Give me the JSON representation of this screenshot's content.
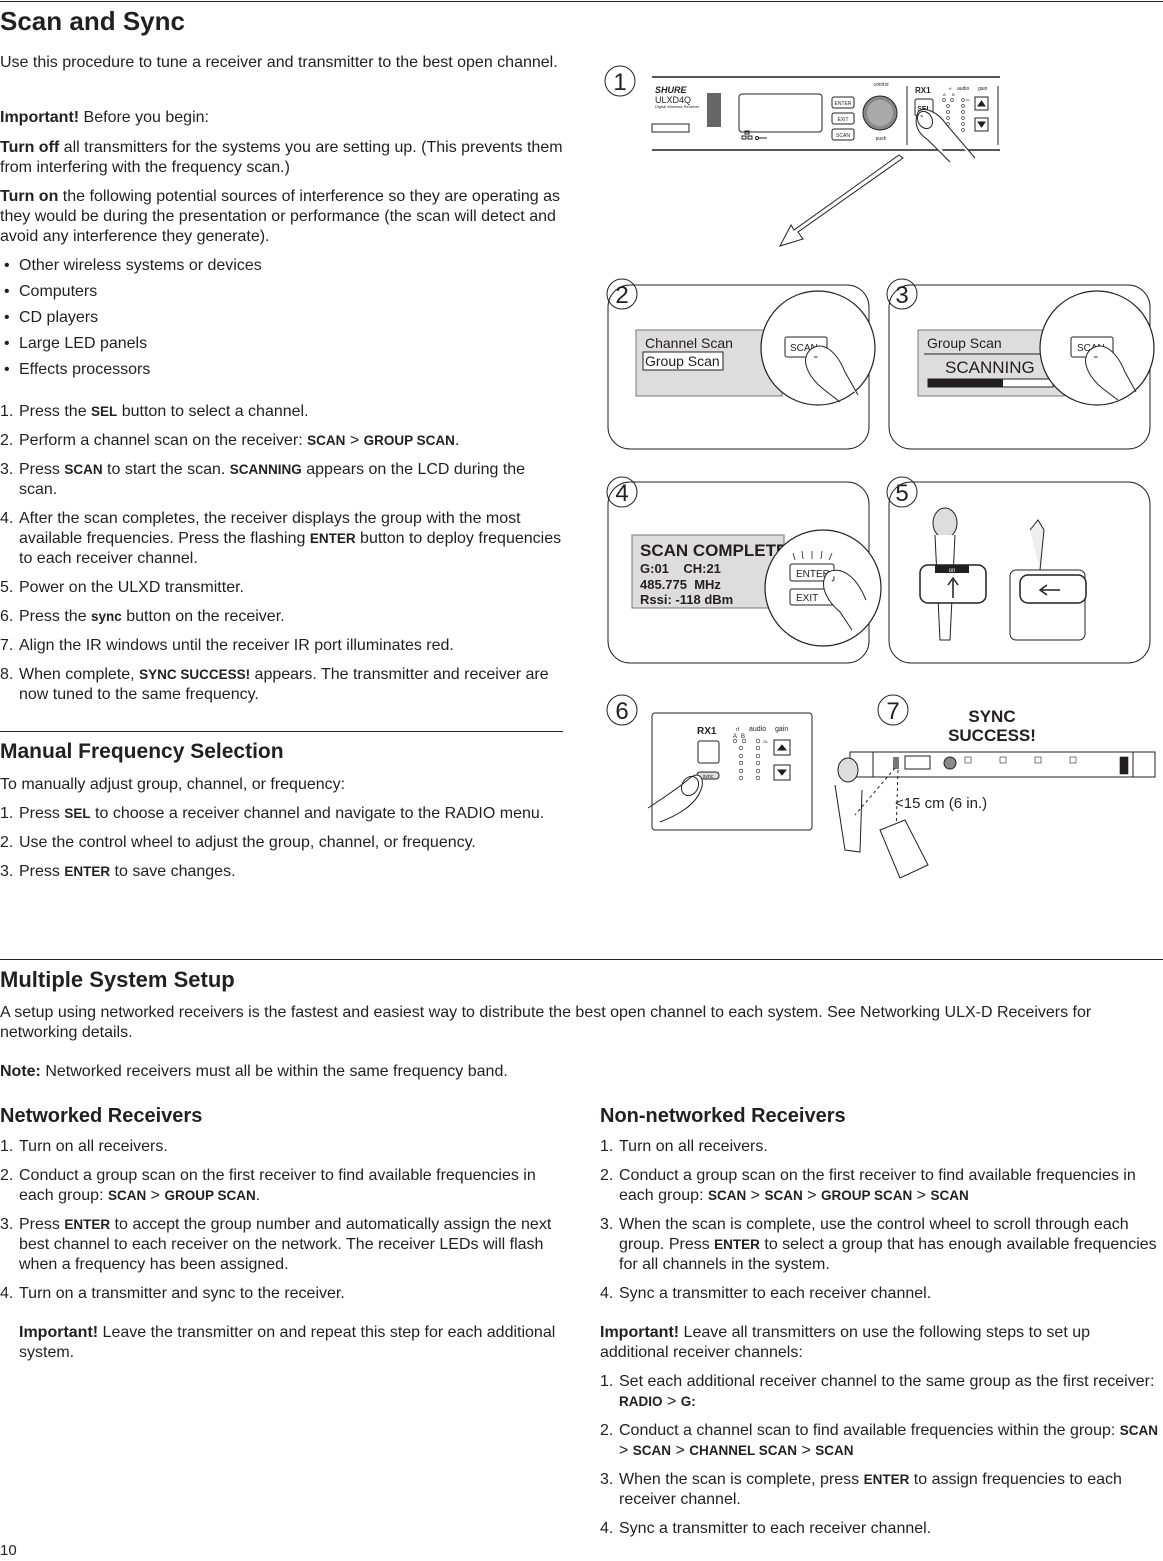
{
  "scan_sync": {
    "title": "Scan and Sync",
    "intro": "Use this procedure to tune a receiver and transmitter to the best open channel.",
    "important": {
      "label": "Important!",
      "text": " Before you begin:"
    },
    "turn_off": {
      "label": "Turn off",
      "text": " all transmitters for the systems you are setting up. (This prevents them from interfering with the frequency scan.)"
    },
    "turn_on": {
      "label": "Turn on",
      "text": " the following potential sources of interference so they are operating as they would be during the presentation or performance (the scan will detect and avoid any interference they generate)."
    },
    "bullets": [
      "Other wireless systems or devices",
      "Computers",
      "CD players",
      "Large LED panels",
      "Effects processors"
    ],
    "steps": [
      {
        "n": "1.",
        "runs": [
          {
            "t": "Press the "
          },
          {
            "t": "SEL",
            "b": true
          },
          {
            "t": " button to select a channel."
          }
        ]
      },
      {
        "n": "2.",
        "runs": [
          {
            "t": "Perform a channel scan on the receiver: "
          },
          {
            "t": "SCAN",
            "b": true
          },
          {
            "t": " > "
          },
          {
            "t": "GROUP SCAN",
            "b": true
          },
          {
            "t": "."
          }
        ]
      },
      {
        "n": "3.",
        "runs": [
          {
            "t": "Press "
          },
          {
            "t": "SCAN",
            "b": true
          },
          {
            "t": " to start the scan. "
          },
          {
            "t": "SCANNING",
            "b": true
          },
          {
            "t": " appears on the LCD during the scan."
          }
        ]
      },
      {
        "n": "4.",
        "runs": [
          {
            "t": "After the scan completes, the receiver displays the group with the most available frequencies. Press the flashing "
          },
          {
            "t": "ENTER",
            "b": true
          },
          {
            "t": " button to deploy frequencies to each receiver channel."
          }
        ]
      },
      {
        "n": "5.",
        "runs": [
          {
            "t": "Power on the ULXD transmitter."
          }
        ]
      },
      {
        "n": "6.",
        "runs": [
          {
            "t": "Press the "
          },
          {
            "t": "sync",
            "b": true
          },
          {
            "t": " button on the receiver."
          }
        ]
      },
      {
        "n": "7.",
        "runs": [
          {
            "t": "Align the IR windows until the receiver IR port illuminates red."
          }
        ]
      },
      {
        "n": "8.",
        "runs": [
          {
            "t": "When complete, "
          },
          {
            "t": "SYNC SUCCESS!",
            "b": true
          },
          {
            "t": " appears. The transmitter and receiver are now tuned to the same frequency."
          }
        ]
      }
    ]
  },
  "manual": {
    "title": "Manual Frequency Selection",
    "intro": "To manually adjust group, channel, or frequency:",
    "steps": [
      {
        "n": "1.",
        "runs": [
          {
            "t": "Press "
          },
          {
            "t": "SEL",
            "b": true
          },
          {
            "t": " to choose a receiver channel and navigate to the RADIO menu."
          }
        ]
      },
      {
        "n": "2.",
        "runs": [
          {
            "t": "Use the control wheel to adjust the group, channel, or frequency."
          }
        ]
      },
      {
        "n": "3.",
        "runs": [
          {
            "t": "Press "
          },
          {
            "t": "ENTER",
            "b": true
          },
          {
            "t": " to save changes."
          }
        ]
      }
    ]
  },
  "multiple": {
    "title": "Multiple System Setup",
    "intro": "A setup using networked receivers is the fastest and easiest way to distribute the best open channel to each system. See Networking ULX-D Receivers for networking details.",
    "note": {
      "label": "Note:",
      "text": " Networked receivers must all be within the same frequency band."
    },
    "networked": {
      "title": "Networked Receivers",
      "steps": [
        {
          "n": "1.",
          "runs": [
            {
              "t": "Turn on all receivers."
            }
          ]
        },
        {
          "n": "2.",
          "runs": [
            {
              "t": "Conduct a group scan on the first receiver to find available frequencies in each group: "
            },
            {
              "t": "SCAN",
              "b": true
            },
            {
              "t": " > "
            },
            {
              "t": "GROUP SCAN",
              "b": true
            },
            {
              "t": "."
            }
          ]
        },
        {
          "n": "3.",
          "runs": [
            {
              "t": "Press "
            },
            {
              "t": "ENTER",
              "b": true
            },
            {
              "t": " to accept the group number and automatically assign the next best channel to each receiver on the network. The receiver LEDs will flash when a frequency has been assigned."
            }
          ]
        },
        {
          "n": "4.",
          "runs": [
            {
              "t": "Turn on a transmitter and sync to the receiver."
            }
          ]
        }
      ],
      "important": {
        "label": "Important!",
        "text": " Leave the transmitter on and repeat this step for each additional system."
      }
    },
    "non_networked": {
      "title": "Non-networked Receivers",
      "steps": [
        {
          "n": "1.",
          "runs": [
            {
              "t": "Turn on all receivers."
            }
          ]
        },
        {
          "n": "2.",
          "runs": [
            {
              "t": "Conduct a group scan on the first receiver to find available frequencies in each group: "
            },
            {
              "t": "SCAN",
              "b": true
            },
            {
              "t": " > "
            },
            {
              "t": "SCAN",
              "b": true
            },
            {
              "t": " > "
            },
            {
              "t": "GROUP SCAN",
              "b": true
            },
            {
              "t": " > "
            },
            {
              "t": "SCAN",
              "b": true
            }
          ]
        },
        {
          "n": "3.",
          "runs": [
            {
              "t": "When the scan is complete, use the control wheel to scroll through each group. Press "
            },
            {
              "t": "ENTER",
              "b": true
            },
            {
              "t": " to select a group that has enough available frequencies for all channels in the system."
            }
          ]
        },
        {
          "n": "4.",
          "runs": [
            {
              "t": "Sync a transmitter to each receiver channel."
            }
          ]
        }
      ],
      "important": {
        "label": "Important!",
        "text": " Leave all transmitters on use the following steps to set up additional receiver channels:"
      },
      "steps2": [
        {
          "n": "1.",
          "runs": [
            {
              "t": "Set each additional receiver channel to the same group as the first receiver: "
            },
            {
              "t": "RADIO",
              "b": true
            },
            {
              "t": " > "
            },
            {
              "t": "G:",
              "b": true
            }
          ]
        },
        {
          "n": "2.",
          "runs": [
            {
              "t": "Conduct a channel scan to find available frequencies within the group: "
            },
            {
              "t": "SCAN",
              "b": true
            },
            {
              "t": " > "
            },
            {
              "t": "SCAN",
              "b": true
            },
            {
              "t": " > "
            },
            {
              "t": "CHANNEL SCAN",
              "b": true
            },
            {
              "t": " > "
            },
            {
              "t": "SCAN",
              "b": true
            }
          ]
        },
        {
          "n": "3.",
          "runs": [
            {
              "t": "When the scan is complete, press "
            },
            {
              "t": "ENTER",
              "b": true
            },
            {
              "t": " to assign frequencies to each receiver channel."
            }
          ]
        },
        {
          "n": "4.",
          "runs": [
            {
              "t": "Sync a transmitter to each receiver channel."
            }
          ]
        }
      ]
    }
  },
  "page_number": "10",
  "figures": {
    "numbers": [
      "1",
      "2",
      "3",
      "4",
      "5",
      "6",
      "7"
    ],
    "fig1": {
      "brand": "SHURE",
      "model": "ULXD4Q",
      "subtitle": "Digital Wireless Receiver",
      "control": "control",
      "push": "push",
      "enter": "ENTER",
      "exit": "EXIT",
      "scan": "SCAN",
      "channel": "RX1",
      "sel": "SEL",
      "rf": "rf",
      "audio": "audio",
      "gain": "gain",
      "a": "A",
      "b": "B",
      "ol": "OL"
    },
    "fig2": {
      "line1": "Channel Scan",
      "line2": "Group Scan",
      "button": "SCAN"
    },
    "fig3": {
      "line1": "Group Scan",
      "line2": "SCANNING",
      "button": "SCAN",
      "progress": 0.6
    },
    "fig4": {
      "line1": "SCAN COMPLETE",
      "line2": "G:01    CH:21",
      "line3": "485.775  MHz",
      "line4": "Rssi: -118 dBm",
      "enter": "ENTER",
      "exit": "EXIT"
    },
    "fig5": {
      "switch": "on"
    },
    "fig6": {
      "channel": "RX1",
      "rf": "rf",
      "audio": "audio",
      "gain": "gain",
      "a": "A",
      "b": "B",
      "ol": "OL",
      "sync": "sync"
    },
    "fig7": {
      "line1": "SYNC",
      "line2": "SUCCESS!",
      "distance": "<15 cm (6 in.)"
    }
  }
}
